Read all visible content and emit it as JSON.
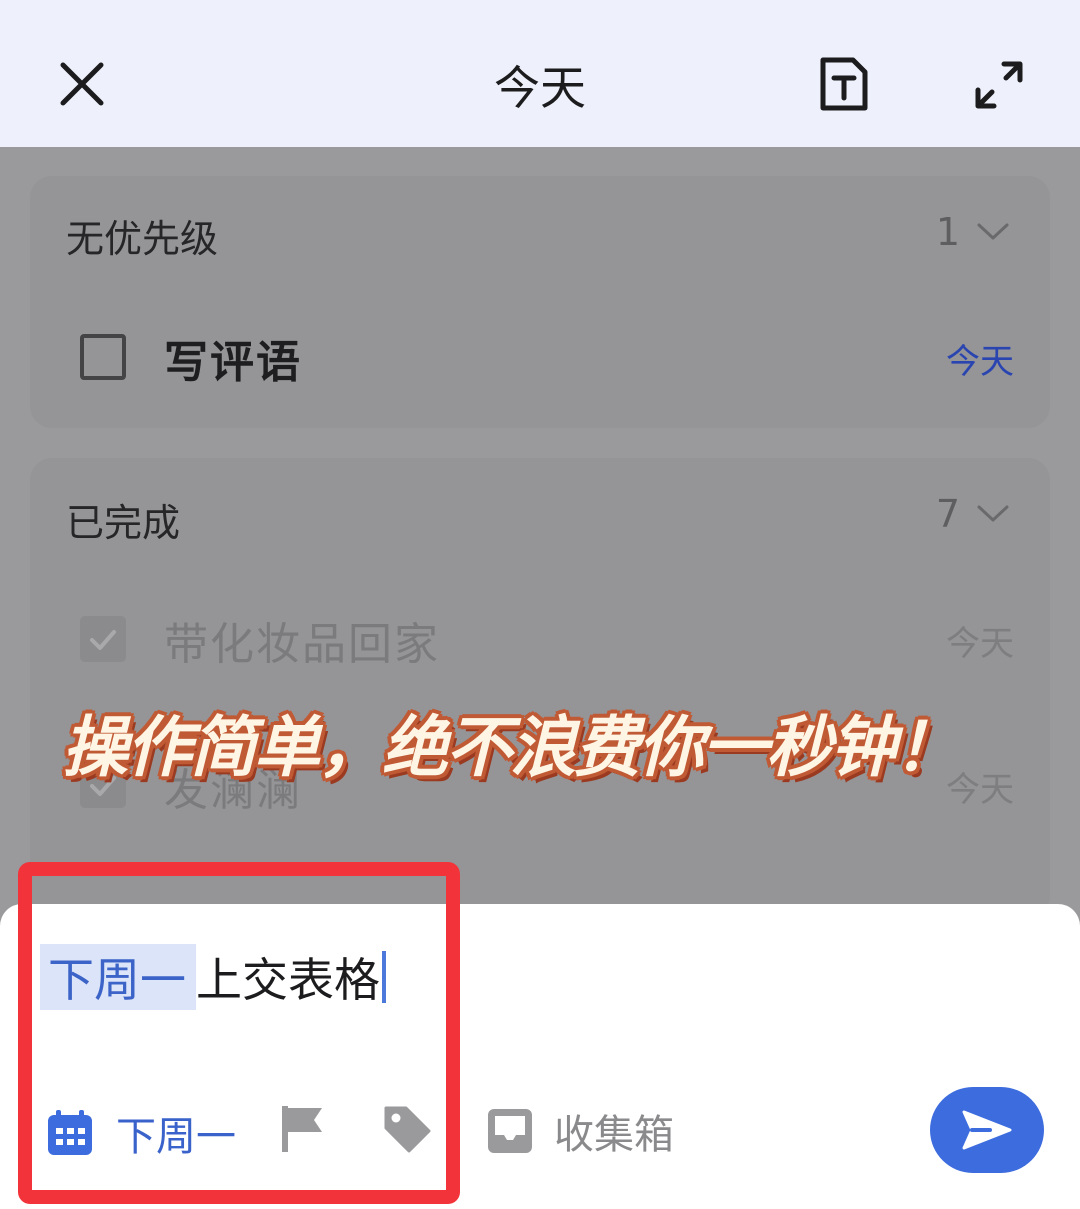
{
  "header": {
    "title": "今天"
  },
  "groups": [
    {
      "name": "无优先级",
      "count": "1",
      "tasks": [
        {
          "title": "写评语",
          "date": "今天",
          "done": false
        }
      ]
    },
    {
      "name": "已完成",
      "count": "7",
      "tasks": [
        {
          "title": "带化妆品回家",
          "date": "今天",
          "done": true
        },
        {
          "title": "发澜澜",
          "date": "今天",
          "done": true
        }
      ]
    }
  ],
  "banner": {
    "text": "操作简单，绝不浪费你一秒钟！"
  },
  "quick_add": {
    "highlighted_text": "下周一",
    "input_text": "上交表格",
    "date_label": "下周一",
    "list_label": "收集箱"
  },
  "colors": {
    "accent": "#3c6cde",
    "frame": "#f3333a",
    "highlight": "#dbe4f8"
  }
}
